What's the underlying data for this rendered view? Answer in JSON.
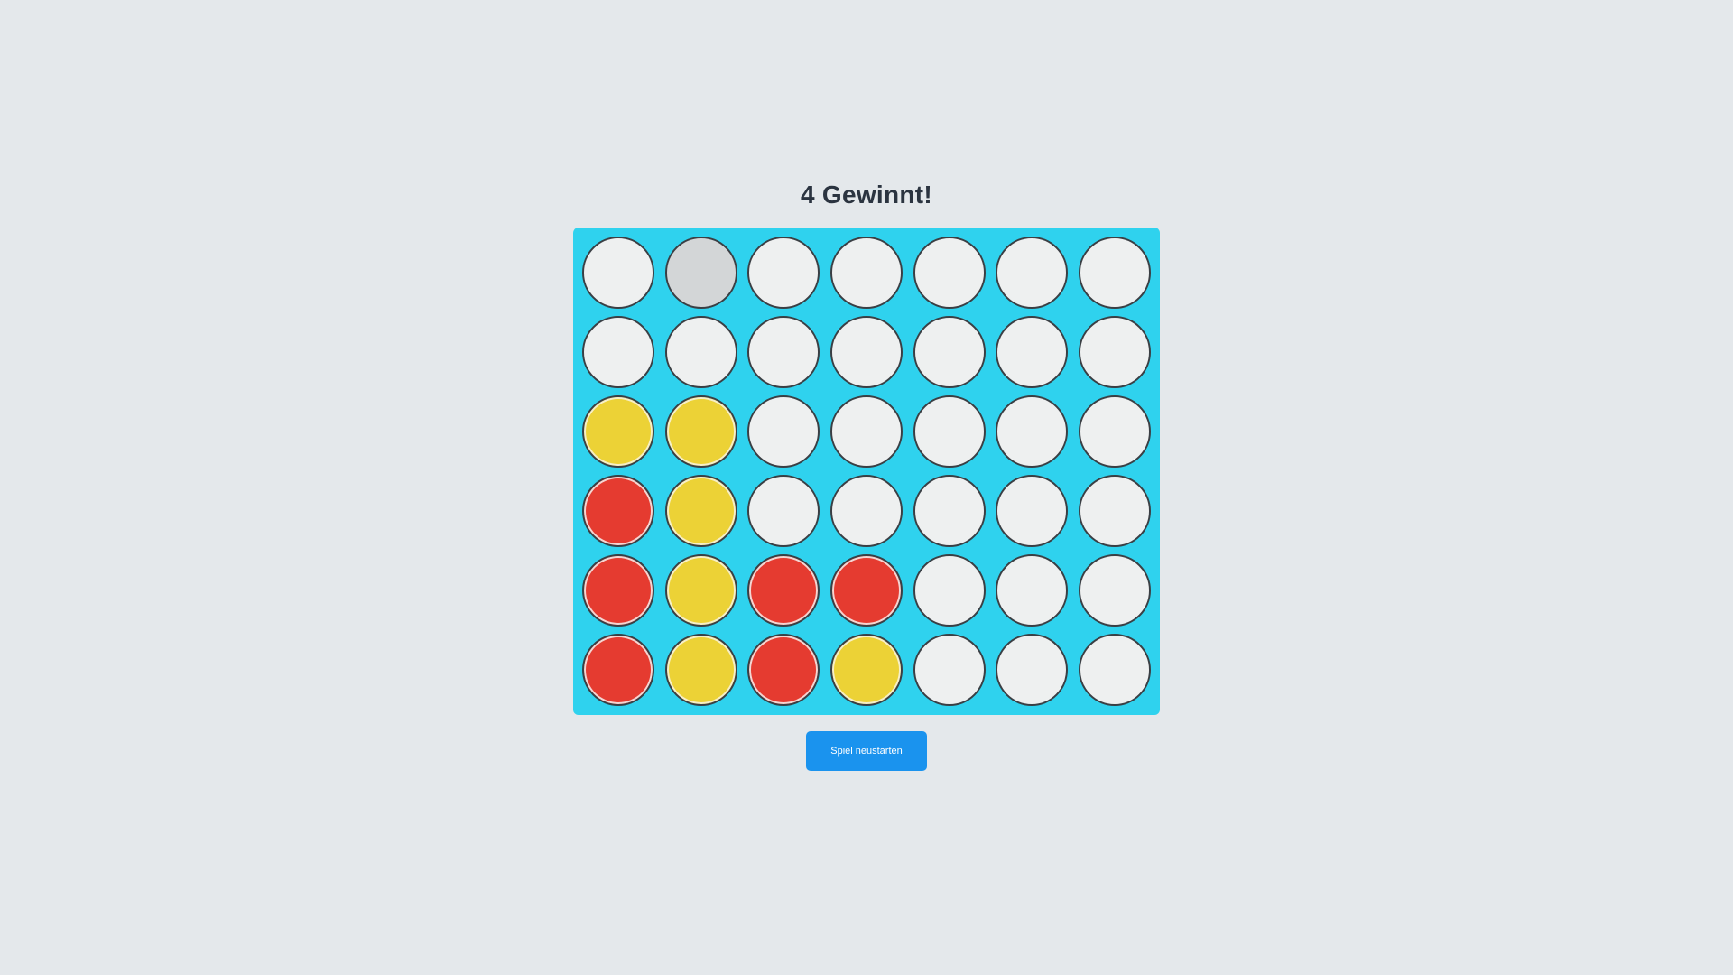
{
  "game": {
    "title": "4 Gewinnt!",
    "restart_label": "Spiel neustarten",
    "colors": {
      "board": "#2fd2ee",
      "empty": "#eef0f0",
      "red": "#e53b30",
      "yellow": "#ecd236",
      "button": "#1a93ee"
    },
    "hover_cell": {
      "row": 1,
      "col": 2
    },
    "board": [
      [
        "empty",
        "empty",
        "empty",
        "empty",
        "empty",
        "empty",
        "empty"
      ],
      [
        "empty",
        "empty",
        "empty",
        "empty",
        "empty",
        "empty",
        "empty"
      ],
      [
        "yellow",
        "yellow",
        "empty",
        "empty",
        "empty",
        "empty",
        "empty"
      ],
      [
        "red",
        "yellow",
        "empty",
        "empty",
        "empty",
        "empty",
        "empty"
      ],
      [
        "red",
        "yellow",
        "red",
        "red",
        "empty",
        "empty",
        "empty"
      ],
      [
        "red",
        "yellow",
        "red",
        "yellow",
        "empty",
        "empty",
        "empty"
      ]
    ]
  }
}
